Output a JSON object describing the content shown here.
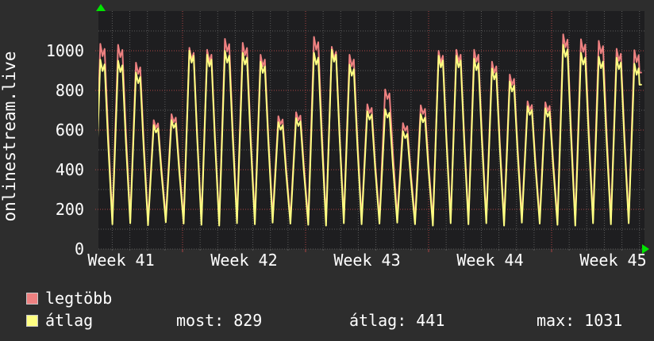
{
  "app": {
    "vertical_title": "onlinestream.live"
  },
  "colors": {
    "page_bg": "#2d2d2d",
    "plot_bg": "#1e1e20",
    "text": "#ffffff",
    "grid_minor": "#5a5a5a",
    "grid_major": "#a94444",
    "axis_arrow": "#00e400",
    "series_max": "#ee8181",
    "series_avg": "#ffff82",
    "legend_swatch_border": "#c8c8c8"
  },
  "legend": {
    "items": [
      {
        "label": "legtöbb",
        "color": "#ee8181"
      },
      {
        "label": "átlag",
        "color": "#ffff82"
      }
    ]
  },
  "stats": {
    "most_label": "most:",
    "most_value": "829",
    "avg_label": "átlag:",
    "avg_value": "441",
    "max_label": "max:",
    "max_value": "1031"
  },
  "chart_data": {
    "type": "line",
    "title": "onlinestream.live",
    "ylim": [
      0,
      1200
    ],
    "y_major_step": 200,
    "y_minor_step": 100,
    "y_tick_labels": [
      "0",
      "200",
      "400",
      "600",
      "800",
      "1000"
    ],
    "x_tick_labels": [
      "Week 41",
      "Week 42",
      "Week 43",
      "Week 44",
      "Week 45"
    ],
    "x_unit": "day",
    "days_per_week": 7,
    "grid": "dotted",
    "legend_position": "bottom-left",
    "series": [
      {
        "name": "legtöbb",
        "role": "daily-maximum",
        "color": "#ee8181",
        "peaks": [
          1035,
          1030,
          940,
          650,
          680,
          1015,
          1005,
          1060,
          1040,
          980,
          670,
          690,
          1070,
          1020,
          980,
          730,
          805,
          635,
          725,
          1000,
          1005,
          1005,
          945,
          880,
          745,
          740,
          1083,
          1058,
          1050,
          1010,
          1003
        ],
        "troughs": [
          148,
          152,
          142,
          158,
          150,
          145,
          140,
          152,
          148,
          158,
          150,
          145,
          140,
          152,
          148,
          150,
          158,
          148,
          140,
          152,
          148,
          152,
          140,
          158,
          150,
          145,
          140,
          152,
          148,
          152,
          148
        ],
        "current": 890
      },
      {
        "name": "átlag",
        "role": "daily-average",
        "color": "#ffff82",
        "peaks": [
          955,
          950,
          890,
          625,
          650,
          1000,
          980,
          1000,
          990,
          945,
          640,
          660,
          990,
          1005,
          930,
          695,
          705,
          595,
          680,
          975,
          975,
          960,
          910,
          845,
          720,
          710,
          1031,
          990,
          970,
          965,
          935
        ],
        "troughs": [
          125,
          130,
          120,
          135,
          128,
          122,
          118,
          130,
          125,
          133,
          128,
          122,
          118,
          130,
          125,
          128,
          133,
          125,
          118,
          130,
          125,
          130,
          118,
          133,
          128,
          122,
          118,
          130,
          125,
          130,
          125
        ],
        "current": 829
      }
    ],
    "summary": {
      "most": 829,
      "atlag": 441,
      "max": 1031
    }
  }
}
